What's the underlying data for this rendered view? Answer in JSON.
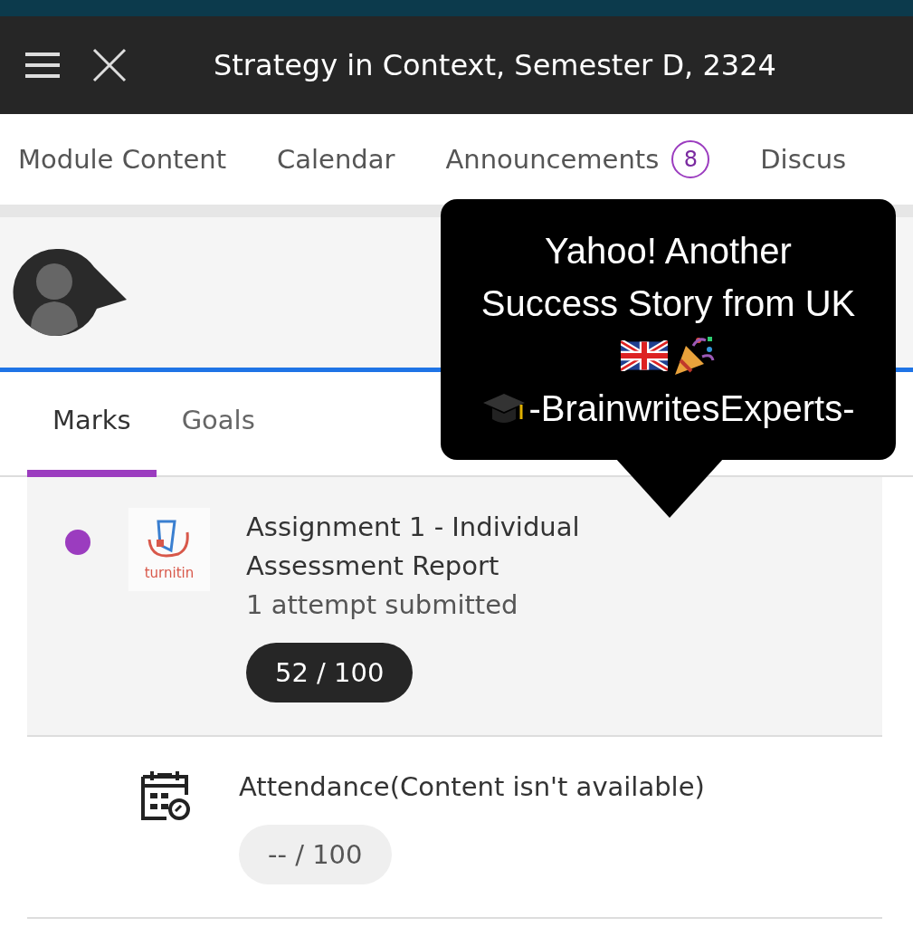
{
  "header": {
    "title": "Strategy in Context, Semester D, 2324"
  },
  "nav_tabs": [
    {
      "label": "Module Content",
      "selected": false
    },
    {
      "label": "Calendar",
      "selected": false
    },
    {
      "label": "Announcements",
      "badge": "8",
      "selected": false
    },
    {
      "label": "Discus",
      "selected": false
    }
  ],
  "sub_tabs": [
    {
      "label": "Marks",
      "selected": true
    },
    {
      "label": "Goals",
      "selected": false
    }
  ],
  "items": [
    {
      "kind": "turnitin",
      "logo_text": "turnitin",
      "unread": true,
      "title": "Assignment 1 - Individual Assessment Report",
      "subtitle": "1 attempt submitted",
      "grade": "52 / 100",
      "graded": true
    },
    {
      "kind": "attendance",
      "unread": false,
      "title": "Attendance(Content isn't available)",
      "grade": "-- / 100",
      "graded": false
    }
  ],
  "callout": {
    "lines": [
      "Yahoo! Another",
      "Success Story from UK"
    ],
    "signature": "-BrainwritesExperts-"
  }
}
